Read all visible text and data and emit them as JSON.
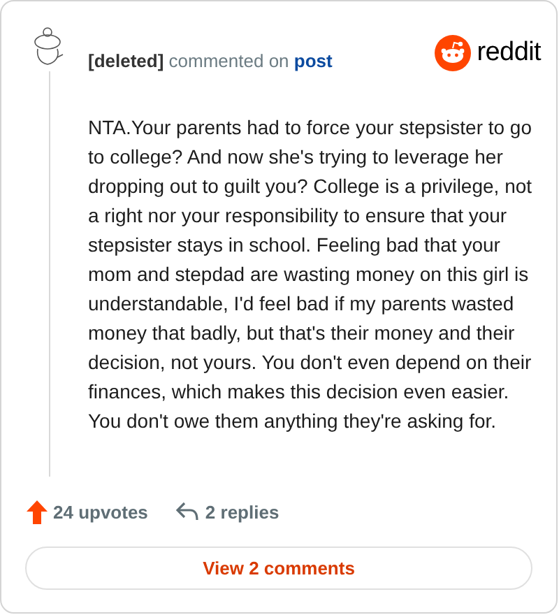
{
  "header": {
    "author": "[deleted]",
    "action": "commented on",
    "link": "post",
    "brand": "reddit"
  },
  "body": "NTA.Your parents had to force your stepsister to go to college? And now she's trying to leverage her dropping out to guilt you? College is a privilege, not a right nor your responsibility to ensure that your stepsister stays in school. Feeling bad that your mom and stepdad are wasting money on this girl is understandable, I'd feel bad if my parents wasted money that badly, but that's their money and their decision, not yours. You don't even depend on their finances, which makes this decision even easier. You don't owe them anything they're asking for.",
  "stats": {
    "upvotes": "24 upvotes",
    "replies": "2 replies"
  },
  "button": "View 2 comments"
}
